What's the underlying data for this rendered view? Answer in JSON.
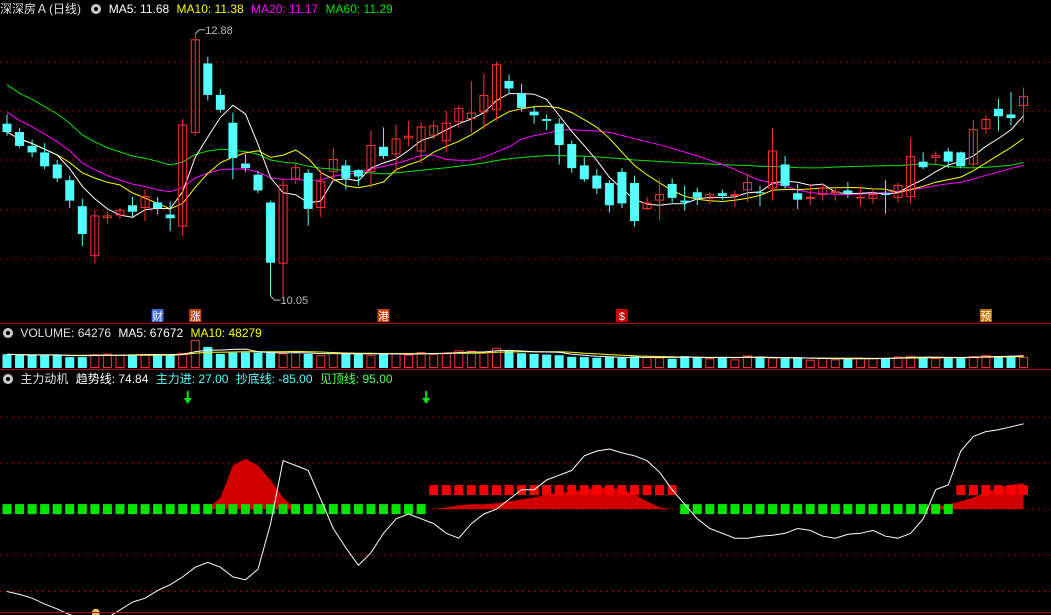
{
  "header": {
    "stock_name": "深深房Ａ",
    "period": "(日线)",
    "ma5_label": "MA5: 11.68",
    "ma10_label": "MA10: 11.38",
    "ma20_label": "MA20: 11.17",
    "ma60_label": "MA60: 11.29"
  },
  "volume_header": {
    "volume_label": "VOLUME: 64276",
    "ma5_label": "MA5: 67672",
    "ma10_label": "MA10: 48279"
  },
  "indicator_header": {
    "name": "主力动机",
    "trend_label": "趋势线: 74.84",
    "main_in_label": "主力进: 27.00",
    "bottom_label": "抄底线: -85.00",
    "top_label": "见顶线: 95.00"
  },
  "annotations": {
    "high_label": "12.88",
    "low_label": "10.05",
    "events": [
      "财",
      "涨",
      "港",
      "$",
      "预"
    ]
  },
  "colors": {
    "up": "#ff3232",
    "down": "#54ffff",
    "ma5": "#ffffff",
    "ma10": "#ffff00",
    "ma20": "#ff00ff",
    "ma60": "#00e600",
    "grid": "#a00000",
    "main_force": "#d00000",
    "green_block": "#00e600"
  },
  "chart_data": [
    {
      "type": "candlestick",
      "title": "深深房Ａ (日线)",
      "ylim": [
        9.9,
        13.05
      ],
      "series_names": [
        "MA5",
        "MA10",
        "MA20",
        "MA60"
      ],
      "candles": [
        [
          11.91,
          12.01,
          11.78,
          11.82
        ],
        [
          11.82,
          11.86,
          11.65,
          11.67
        ],
        [
          11.67,
          11.74,
          11.55,
          11.6
        ],
        [
          11.6,
          11.7,
          11.42,
          11.45
        ],
        [
          11.47,
          11.52,
          11.28,
          11.32
        ],
        [
          11.3,
          11.35,
          11.0,
          11.08
        ],
        [
          11.02,
          11.1,
          10.59,
          10.72
        ],
        [
          10.48,
          10.98,
          10.4,
          10.92
        ],
        [
          10.89,
          10.97,
          10.83,
          10.92
        ],
        [
          10.92,
          11.0,
          10.88,
          10.98
        ],
        [
          11.03,
          11.12,
          10.91,
          10.96
        ],
        [
          11.0,
          11.2,
          10.86,
          11.13
        ],
        [
          11.06,
          11.12,
          10.93,
          11.0
        ],
        [
          10.93,
          11.07,
          10.75,
          10.89
        ],
        [
          10.8,
          11.96,
          10.7,
          11.9
        ],
        [
          11.81,
          12.88,
          11.78,
          12.82
        ],
        [
          12.56,
          12.63,
          12.16,
          12.22
        ],
        [
          12.22,
          12.28,
          12.03,
          12.06
        ],
        [
          11.92,
          12.03,
          11.31,
          11.54
        ],
        [
          11.48,
          11.58,
          11.39,
          11.43
        ],
        [
          11.36,
          11.4,
          11.16,
          11.19
        ],
        [
          11.06,
          11.08,
          10.05,
          10.41
        ],
        [
          10.4,
          11.32,
          10.05,
          11.25
        ],
        [
          11.31,
          11.48,
          11.26,
          11.44
        ],
        [
          11.38,
          11.42,
          10.81,
          10.99
        ],
        [
          11.0,
          11.41,
          10.9,
          11.29
        ],
        [
          11.39,
          11.65,
          11.29,
          11.53
        ],
        [
          11.46,
          11.52,
          11.2,
          11.32
        ],
        [
          11.41,
          11.42,
          11.24,
          11.34
        ],
        [
          11.39,
          11.84,
          11.22,
          11.68
        ],
        [
          11.66,
          11.87,
          11.53,
          11.56
        ],
        [
          11.58,
          11.9,
          11.39,
          11.75
        ],
        [
          11.75,
          11.94,
          11.67,
          11.78
        ],
        [
          11.61,
          11.93,
          11.48,
          11.88
        ],
        [
          11.78,
          11.94,
          11.74,
          11.89
        ],
        [
          11.72,
          12.05,
          11.6,
          11.92
        ],
        [
          11.93,
          12.11,
          11.87,
          12.08
        ],
        [
          11.96,
          12.37,
          11.81,
          12.03
        ],
        [
          12.03,
          12.45,
          11.85,
          12.22
        ],
        [
          12.06,
          12.58,
          11.94,
          12.55
        ],
        [
          12.37,
          12.44,
          12.23,
          12.29
        ],
        [
          12.24,
          12.34,
          12.04,
          12.08
        ],
        [
          12.04,
          12.1,
          11.91,
          12.0
        ],
        [
          11.96,
          12.01,
          11.84,
          11.94
        ],
        [
          11.91,
          11.97,
          11.47,
          11.68
        ],
        [
          11.69,
          11.73,
          11.38,
          11.43
        ],
        [
          11.46,
          11.55,
          11.28,
          11.31
        ],
        [
          11.35,
          11.42,
          11.15,
          11.21
        ],
        [
          11.27,
          11.3,
          10.95,
          11.03
        ],
        [
          11.39,
          11.43,
          11.0,
          11.05
        ],
        [
          11.27,
          11.35,
          10.8,
          10.86
        ],
        [
          10.99,
          11.12,
          10.98,
          11.06
        ],
        [
          11.08,
          11.31,
          10.87,
          11.15
        ],
        [
          11.26,
          11.32,
          11.06,
          11.11
        ],
        [
          11.08,
          11.24,
          10.97,
          11.06
        ],
        [
          11.17,
          11.22,
          11.03,
          11.11
        ],
        [
          11.1,
          11.17,
          11.04,
          11.15
        ],
        [
          11.16,
          11.2,
          11.09,
          11.13
        ],
        [
          11.13,
          11.19,
          11.01,
          11.15
        ],
        [
          11.19,
          11.37,
          11.07,
          11.28
        ],
        [
          11.17,
          11.24,
          11.02,
          11.16
        ],
        [
          11.21,
          11.86,
          11.08,
          11.62
        ],
        [
          11.47,
          11.56,
          11.21,
          11.24
        ],
        [
          11.16,
          11.26,
          10.99,
          11.09
        ],
        [
          11.1,
          11.25,
          11.03,
          11.12
        ],
        [
          11.14,
          11.26,
          11.08,
          11.22
        ],
        [
          11.16,
          11.22,
          11.08,
          11.18
        ],
        [
          11.19,
          11.28,
          11.11,
          11.16
        ],
        [
          11.12,
          11.23,
          11.02,
          11.12
        ],
        [
          11.1,
          11.21,
          11.05,
          11.15
        ],
        [
          11.16,
          11.3,
          10.94,
          11.14
        ],
        [
          11.11,
          11.27,
          11.06,
          11.25
        ],
        [
          11.12,
          11.76,
          11.05,
          11.56
        ],
        [
          11.5,
          11.6,
          11.42,
          11.44
        ],
        [
          11.54,
          11.61,
          11.48,
          11.57
        ],
        [
          11.61,
          11.65,
          11.43,
          11.5
        ],
        [
          11.6,
          11.61,
          11.43,
          11.45
        ],
        [
          11.47,
          11.95,
          11.44,
          11.85
        ],
        [
          11.85,
          12.0,
          11.8,
          11.96
        ],
        [
          12.07,
          12.18,
          11.83,
          11.99
        ],
        [
          12.01,
          12.25,
          11.89,
          11.97
        ],
        [
          12.1,
          12.3,
          11.92,
          12.21
        ]
      ]
    },
    {
      "type": "bar",
      "title": "VOLUME",
      "series_names": [
        "MA5",
        "MA10"
      ],
      "values": [
        4.3,
        4.0,
        4.2,
        3.9,
        4.1,
        3.4,
        3.4,
        4.3,
        4.5,
        4.1,
        4.0,
        4.3,
        4.3,
        4.1,
        4.7,
        8.7,
        6.6,
        4.4,
        4.8,
        4.9,
        4.8,
        4.7,
        4.6,
        5.0,
        4.4,
        4.0,
        5.0,
        4.5,
        4.3,
        4.0,
        4.4,
        4.6,
        4.2,
        5.0,
        4.4,
        4.9,
        5.5,
        5.4,
        4.9,
        6.3,
        5.4,
        4.6,
        4.4,
        4.2,
        4.0,
        3.5,
        3.4,
        3.2,
        3.4,
        3.2,
        3.6,
        3.5,
        3.3,
        2.9,
        3.7,
        3.3,
        3.0,
        3.4,
        2.7,
        3.9,
        3.6,
        3.3,
        3.0,
        3.1,
        2.6,
        3.1,
        2.7,
        2.8,
        3.1,
        3.1,
        3.1,
        3.6,
        3.8,
        3.3,
        3.1,
        3.1,
        3.1,
        3.7,
        4.0,
        3.7,
        3.8,
        3.5
      ],
      "ma5": [
        4.3,
        4.1,
        4.1,
        4.1,
        4.1,
        3.9,
        3.8,
        3.9,
        4.0,
        4.0,
        4.1,
        4.2,
        4.2,
        4.2,
        4.3,
        5.1,
        5.6,
        5.6,
        5.8,
        5.9,
        5.1,
        4.8,
        4.7,
        4.8,
        4.7,
        4.5,
        4.5,
        4.5,
        4.4,
        4.4,
        4.4,
        4.4,
        4.3,
        4.4,
        4.5,
        4.6,
        4.8,
        5.0,
        5.0,
        5.4,
        5.5,
        5.3,
        5.1,
        5.0,
        4.9,
        4.3,
        4.0,
        3.7,
        3.5,
        3.3,
        3.3,
        3.3,
        3.3,
        3.3,
        3.4,
        3.3,
        3.2,
        3.3,
        3.2,
        3.4,
        3.4,
        3.3,
        3.2,
        3.2,
        3.1,
        3.0,
        2.9,
        2.9,
        2.9,
        2.9,
        3.0,
        3.1,
        3.3,
        3.4,
        3.4,
        3.3,
        3.3,
        3.3,
        3.5,
        3.6,
        3.7,
        3.8
      ],
      "ma10": [
        4.3,
        4.2,
        4.1,
        4.1,
        4.1,
        4.0,
        4.0,
        4.0,
        4.0,
        4.0,
        4.0,
        4.0,
        4.0,
        4.0,
        4.2,
        4.6,
        4.9,
        4.9,
        5.0,
        5.1,
        5.1,
        5.1,
        5.1,
        5.2,
        5.1,
        5.0,
        4.8,
        4.7,
        4.6,
        4.6,
        4.5,
        4.5,
        4.5,
        4.5,
        4.5,
        4.5,
        4.6,
        4.6,
        4.7,
        4.9,
        5.0,
        5.1,
        5.1,
        5.1,
        5.1,
        4.9,
        4.6,
        4.4,
        4.2,
        4.0,
        3.8,
        3.7,
        3.6,
        3.5,
        3.4,
        3.4,
        3.3,
        3.3,
        3.3,
        3.3,
        3.3,
        3.2,
        3.2,
        3.2,
        3.1,
        3.1,
        3.1,
        3.1,
        3.1,
        3.0,
        3.0,
        3.1,
        3.1,
        3.2,
        3.2,
        3.2,
        3.2,
        3.3,
        3.4,
        3.4,
        3.5,
        3.5
      ]
    },
    {
      "type": "line",
      "title": "主力动机",
      "ylim": [
        -100,
        125
      ],
      "series_names": [
        "趋势线",
        "主力进",
        "抄底线",
        "见顶线"
      ],
      "trend": [
        -85,
        -88,
        -92,
        -98,
        -103,
        -109,
        -112,
        -114,
        -112,
        -104,
        -96,
        -92,
        -84,
        -78,
        -70,
        -60,
        -55,
        -60,
        -70,
        -73,
        -62,
        -15,
        50,
        45,
        40,
        10,
        -20,
        -40,
        -58,
        -45,
        -25,
        -10,
        -5,
        -10,
        -15,
        -25,
        -30,
        -15,
        -5,
        0,
        10,
        20,
        20,
        30,
        35,
        40,
        55,
        60,
        62,
        58,
        55,
        50,
        38,
        20,
        5,
        -10,
        -20,
        -25,
        -30,
        -30,
        -28,
        -27,
        -25,
        -20,
        -22,
        -28,
        -30,
        -26,
        -25,
        -22,
        -28,
        -30,
        -25,
        -10,
        20,
        25,
        60,
        75,
        80,
        82,
        85,
        88
      ],
      "main_force": [
        0,
        0,
        0,
        0,
        0,
        0,
        0,
        0,
        0,
        0,
        0,
        0,
        0,
        0,
        0,
        0,
        0,
        12,
        45,
        52,
        45,
        30,
        12,
        0,
        0,
        0,
        0,
        0,
        0,
        0,
        0,
        0,
        0,
        0,
        0,
        2,
        4,
        5,
        5,
        6,
        8,
        10,
        12,
        15,
        17,
        18,
        20,
        22,
        22,
        20,
        15,
        8,
        2,
        0,
        0,
        0,
        0,
        0,
        0,
        0,
        0,
        0,
        0,
        0,
        0,
        0,
        0,
        0,
        0,
        0,
        0,
        0,
        0,
        0,
        2,
        5,
        8,
        12,
        18,
        22,
        25,
        27
      ],
      "red_blocks": [
        34,
        35,
        36,
        37,
        38,
        39,
        40,
        41,
        42,
        43,
        44,
        45,
        46,
        47,
        48,
        49,
        50,
        51,
        52,
        53,
        76,
        77,
        78,
        79,
        80,
        81
      ],
      "signal_arrows": [
        14,
        33
      ],
      "bottom_line": -85,
      "top_line": 95
    }
  ]
}
